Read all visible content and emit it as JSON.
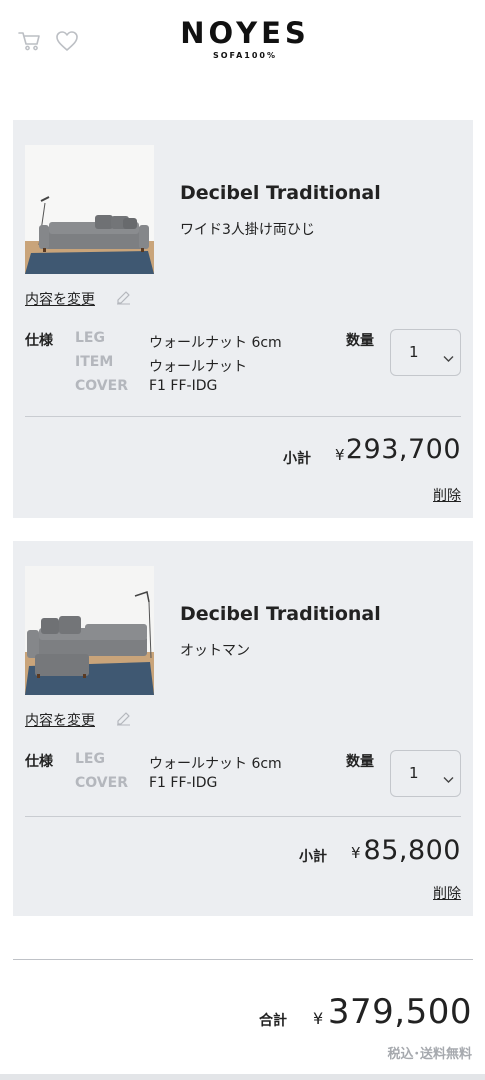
{
  "header": {
    "logo_main": "NOYES",
    "logo_sub": "SOFA100%",
    "icons": [
      "cart-icon",
      "heart-icon"
    ]
  },
  "cart": {
    "items": [
      {
        "name": "Decibel Traditional",
        "variant": "ワイド3人掛け両ひじ",
        "edit_label": "内容を変更",
        "spec_label": "仕様",
        "specs": [
          {
            "key": "LEG",
            "value": "ウォールナット 6cm"
          },
          {
            "key": "ITEM",
            "value": "ウォールナット"
          },
          {
            "key": "COVER",
            "value": "F1 FF-IDG"
          }
        ],
        "qty_label": "数量",
        "qty": "1",
        "subtotal_label": "小計",
        "currency": "¥",
        "subtotal": "293,700",
        "delete_label": "削除",
        "image": "gray-three-seat-sofa-photo"
      },
      {
        "name": "Decibel Traditional",
        "variant": "オットマン",
        "edit_label": "内容を変更",
        "spec_label": "仕様",
        "specs": [
          {
            "key": "LEG",
            "value": "ウォールナット 6cm"
          },
          {
            "key": "COVER",
            "value": "F1 FF-IDG"
          }
        ],
        "qty_label": "数量",
        "qty": "1",
        "subtotal_label": "小計",
        "currency": "¥",
        "subtotal": "85,800",
        "delete_label": "削除",
        "image": "gray-sofa-with-ottoman-photo"
      }
    ]
  },
  "summary": {
    "total_label": "合計",
    "currency": "¥",
    "total": "379,500",
    "tax_note": "税込･送料無料"
  },
  "colors": {
    "card_bg": "#eceef1",
    "text": "#222222",
    "muted": "#b4b7bd",
    "sofa_gray": "#7d7f82",
    "rug_blue": "#3f5872"
  }
}
